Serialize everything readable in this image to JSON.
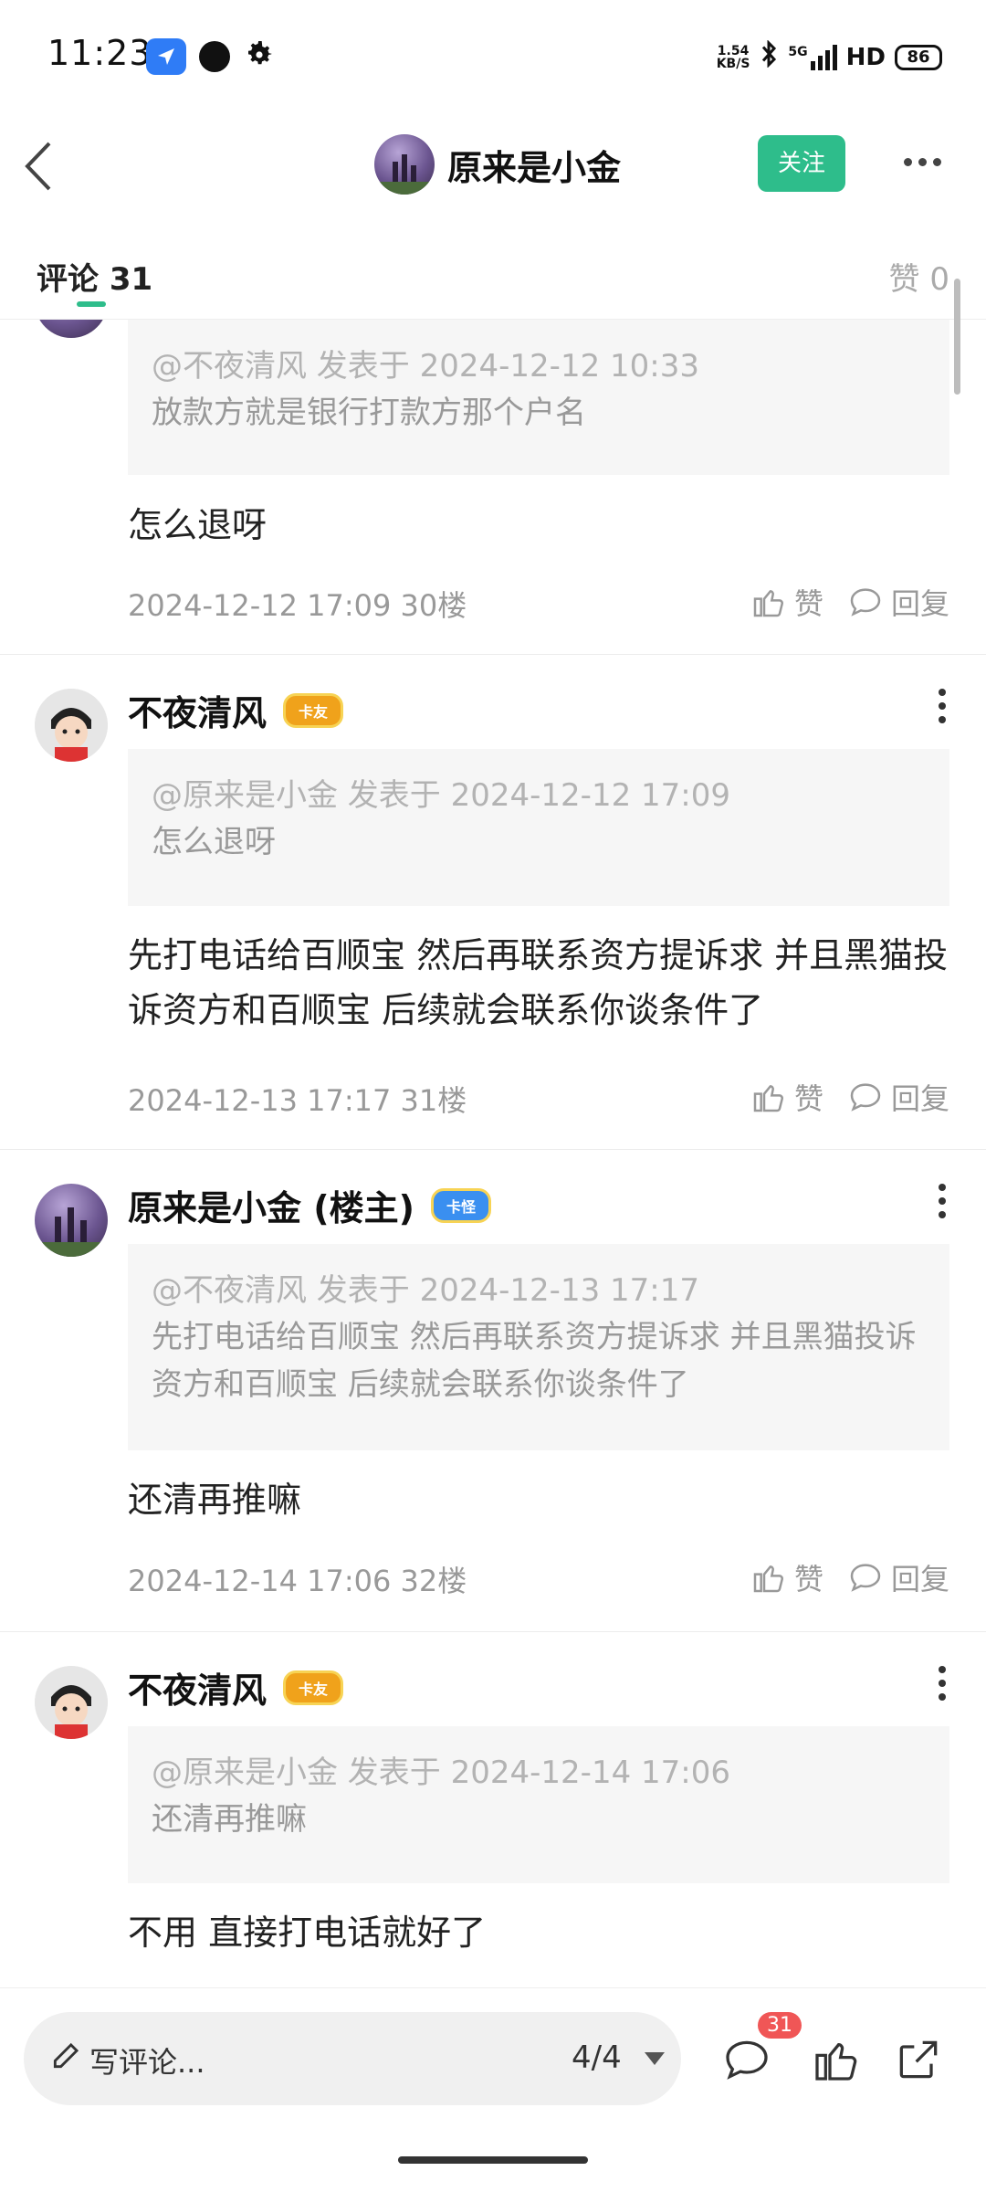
{
  "status_bar": {
    "time": "11:23",
    "net_speed_value": "1.54",
    "net_speed_unit": "KB/S",
    "signal": "5G",
    "hd": "HD",
    "battery": "86"
  },
  "header": {
    "title": "原来是小金",
    "follow_label": "关注"
  },
  "tabs": {
    "comments_label": "评论 31",
    "likes_label": "赞 0"
  },
  "comments": [
    {
      "quote_head": "@不夜清风 发表于 2024-12-12 10:33",
      "quote_body": "放款方就是银行打款方那个户名",
      "content": "怎么退呀",
      "meta": "2024-12-12 17:09  30楼",
      "like_label": "赞",
      "reply_label": "回复"
    },
    {
      "author": "不夜清风",
      "badge": "卡友",
      "quote_head": "@原来是小金 发表于 2024-12-12 17:09",
      "quote_body": "怎么退呀",
      "content": "先打电话给百顺宝 然后再联系资方提诉求 并且黑猫投诉资方和百顺宝 后续就会联系你谈条件了",
      "meta": "2024-12-13 17:17  31楼",
      "like_label": "赞",
      "reply_label": "回复"
    },
    {
      "author": "原来是小金 (楼主)",
      "badge": "卡怪",
      "quote_head": "@不夜清风 发表于 2024-12-13 17:17",
      "quote_body": "先打电话给百顺宝 然后再联系资方提诉求 并且黑猫投诉资方和百顺宝 后续就会联系你谈条件了",
      "content": "还清再推嘛",
      "meta": "2024-12-14 17:06  32楼",
      "like_label": "赞",
      "reply_label": "回复"
    },
    {
      "author": "不夜清风",
      "badge": "卡友",
      "quote_head": "@原来是小金 发表于 2024-12-14 17:06",
      "quote_body": "还清再推嘛",
      "content": "不用 直接打电话就好了"
    }
  ],
  "bottom_bar": {
    "write_placeholder": "写评论...",
    "page_indicator": "4/4",
    "comment_count": "31"
  },
  "colors": {
    "accent": "#2ebd8b",
    "badge_red": "#f05656"
  }
}
